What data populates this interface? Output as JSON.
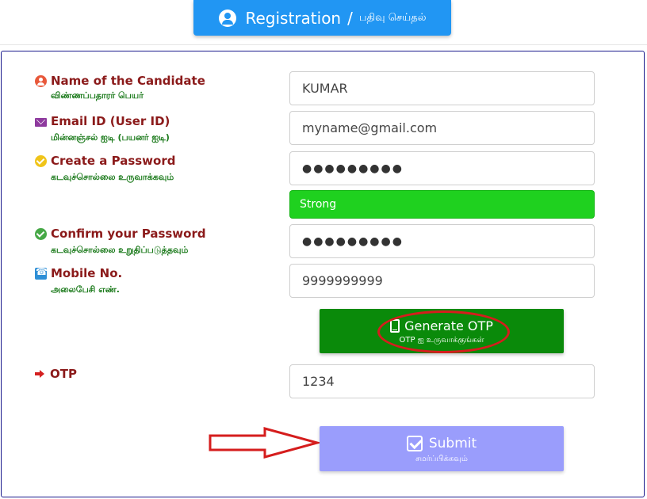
{
  "header": {
    "title": "Registration",
    "separator": "/",
    "subtitle": "பதிவு செய்தல்"
  },
  "form": {
    "name": {
      "label": "Name of the Candidate",
      "sublabel": "விண்ணப்பதாரர் பெயர்",
      "value": "KUMAR"
    },
    "email": {
      "label": "Email ID (User ID)",
      "sublabel": "மின்னஞ்சல் ஐடி (பயனர் ஐடி)",
      "value": "myname@gmail.com"
    },
    "password": {
      "label": "Create a Password",
      "sublabel": "கடவுச்சொல்லை உருவாக்கவும்",
      "value": "●●●●●●●●●"
    },
    "strength": {
      "text": "Strong",
      "color": "#1fd11f"
    },
    "confirm": {
      "label": "Confirm your Password",
      "sublabel": "கடவுச்சொல்லை உறுதிப்படுத்தவும்",
      "value": "●●●●●●●●●"
    },
    "mobile": {
      "label": "Mobile No.",
      "sublabel": "அலைபேசி எண்.",
      "value": "9999999999"
    },
    "otp_button": {
      "label": "Generate OTP",
      "sublabel": "OTP ஐ உருவாக்குங்கள்",
      "color": "#0a8a0a"
    },
    "otp": {
      "label": "OTP",
      "value": "1234"
    },
    "submit": {
      "label": "Submit",
      "sublabel": "சமர்ப்பிக்கவும்",
      "color": "#9a9dfc"
    }
  },
  "annotations": {
    "highlight_color": "#d51d1d",
    "arrow_color": "#d51d1d"
  },
  "icons": [
    "user-circle-icon",
    "envelope-icon",
    "check-circle-icon",
    "phone-icon",
    "sign-in-icon",
    "mobile-icon",
    "check-square-icon"
  ]
}
